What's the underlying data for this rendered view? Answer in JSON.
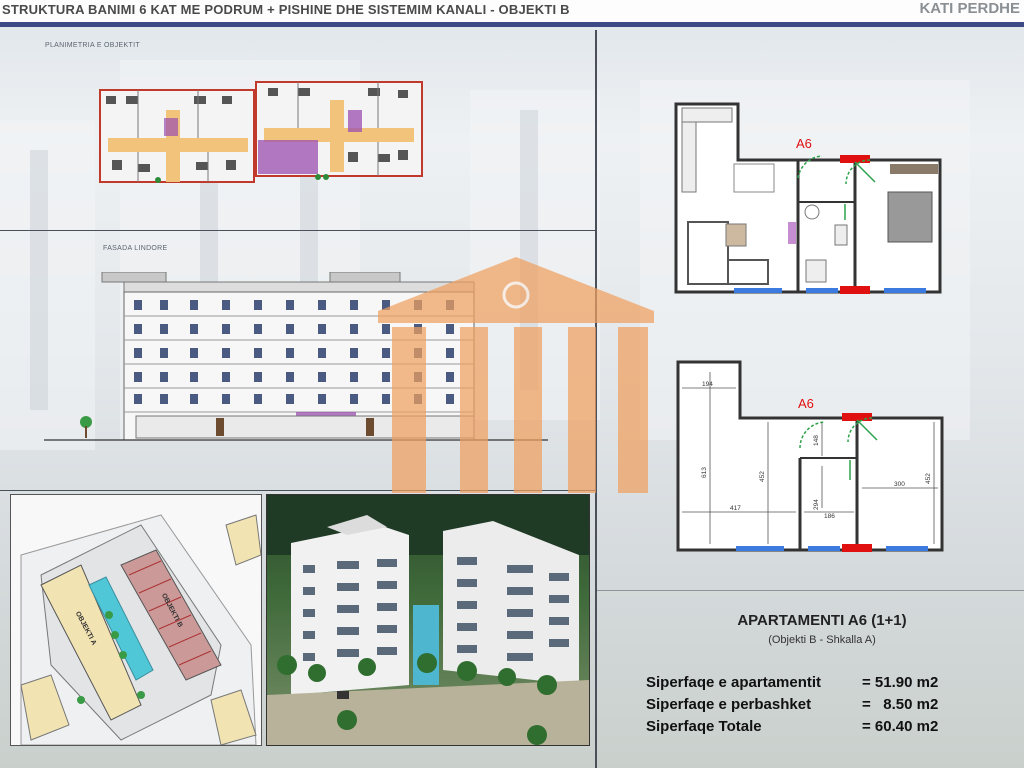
{
  "header": {
    "title": "STRUKTURA BANIMI 6 KAT ME PODRUM + PISHINE DHE SISTEMIM KANALI   - OBJEKTI B",
    "floor": "KATI PERDHE"
  },
  "labels": {
    "plan": "PLANIMETRIA E OBJEKTIT",
    "facade": "FASADA LINDORE"
  },
  "site_plan": {
    "block_a": "OBJEKTI A",
    "block_b": "OBJEKTI B"
  },
  "unit_plan": {
    "tag_top": "A6",
    "tag_bottom": "A6",
    "dims": {
      "d194": "194",
      "d613": "613",
      "d452a": "452",
      "d417": "417",
      "d148": "148",
      "d294": "294",
      "d186": "186",
      "d300": "300",
      "d452b": "452"
    }
  },
  "info": {
    "title": "APARTAMENTI A6 (1+1)",
    "subtitle": "(Objekti B - Shkalla A)",
    "rows": [
      {
        "label": "Siperfaqe e apartamentit",
        "value": "= 51.90 m2"
      },
      {
        "label": "Siperfaqe e perbashket",
        "value": "=   8.50 m2"
      },
      {
        "label": "Siperfaqe Totale",
        "value": "= 60.40 m2"
      }
    ]
  },
  "colors": {
    "header_bar": "#3d4a86",
    "watermark": "#f0a060",
    "door_red": "#e01010",
    "window_blue": "#3b7be0",
    "highlight_purple": "#9b4fb0"
  }
}
